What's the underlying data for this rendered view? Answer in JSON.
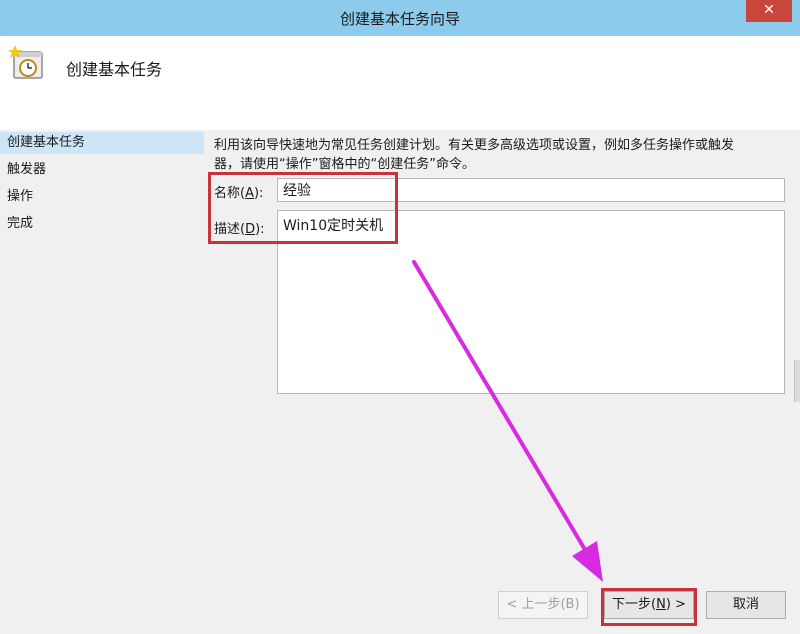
{
  "window": {
    "title": "创建基本任务向导",
    "close_glyph": "✕"
  },
  "header": {
    "heading": "创建基本任务",
    "icon": "task-clock-icon"
  },
  "sidebar": {
    "steps": [
      {
        "label": "创建基本任务",
        "active": true
      },
      {
        "label": "触发器",
        "active": false
      },
      {
        "label": "操作",
        "active": false
      },
      {
        "label": "完成",
        "active": false
      }
    ]
  },
  "main": {
    "intro_line1": "利用该向导快速地为常见任务创建计划。有关更多高级选项或设置，例如多任务操作或触发",
    "intro_line2": "器，请使用“操作”窗格中的“创建任务”命令。",
    "name_label_prefix": "名称(",
    "name_label_key": "A",
    "name_label_suffix": "):",
    "name_value": "经验",
    "desc_label_prefix": "描述(",
    "desc_label_key": "D",
    "desc_label_suffix": "):",
    "desc_value": "Win10定时关机"
  },
  "footer": {
    "back_button": "< 上一步(B)",
    "next_prefix": "下一步(",
    "next_key": "N",
    "next_suffix": ") >",
    "cancel_button": "取消"
  },
  "colors": {
    "titlebar": "#8ccbec",
    "annotation_box": "#c8323b",
    "annotation_arrow": "#d82be0",
    "sidebar_active": "#cce6f7"
  }
}
